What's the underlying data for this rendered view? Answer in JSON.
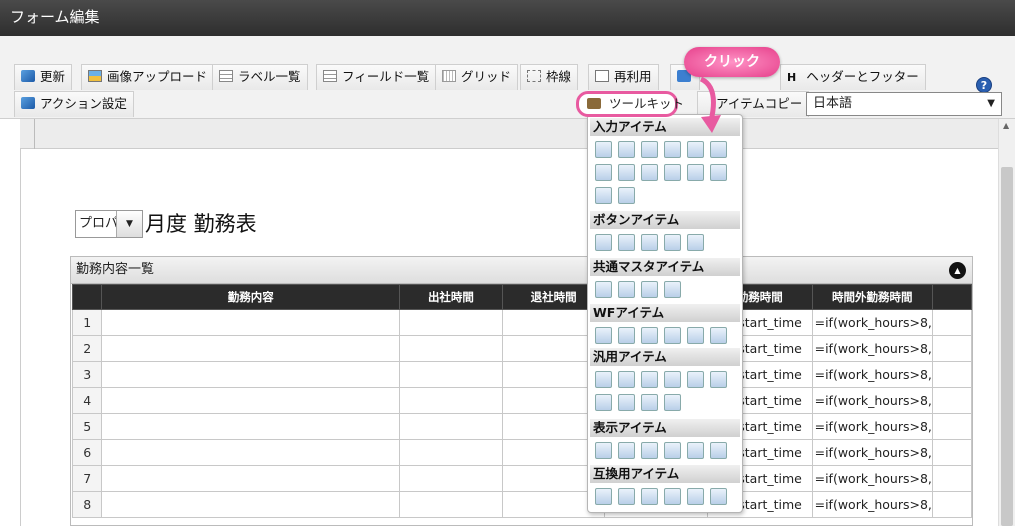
{
  "title": "フォーム編集",
  "toolbar": {
    "row1": [
      "更新",
      "画像アップロード",
      "ラベル一覧",
      "フィールド一覧",
      "グリッド",
      "枠線",
      "再利用",
      "",
      "ヘッダーとフッター"
    ],
    "header_footer_prefix": "H",
    "row2": [
      "アクション設定",
      "ツールキット",
      "アイテムコピー"
    ],
    "language": "日本語"
  },
  "callout": "クリック",
  "form": {
    "period_value": "プロパ",
    "heading": "月度 勤務表",
    "panel_title": "勤務内容一覧",
    "columns": [
      "",
      "勤務内容",
      "出社時間",
      "退社時間",
      "",
      "勤務時間",
      "時間外勤務時間"
    ],
    "rows": [
      {
        "num": "1",
        "work": "and(start_time",
        "overtime": "=if(work_hours>8,"
      },
      {
        "num": "2",
        "work": "and(start_time",
        "overtime": "=if(work_hours>8,"
      },
      {
        "num": "3",
        "work": "and(start_time",
        "overtime": "=if(work_hours>8,"
      },
      {
        "num": "4",
        "work": "and(start_time",
        "overtime": "=if(work_hours>8,"
      },
      {
        "num": "5",
        "work": "and(start_time",
        "overtime": "=if(work_hours>8,"
      },
      {
        "num": "6",
        "work": "and(start_time",
        "overtime": "=if(work_hours>8,"
      },
      {
        "num": "7",
        "work": "and(start_time",
        "overtime": "=if(work_hours>8,"
      },
      {
        "num": "8",
        "work": "and(start_time",
        "overtime": "=if(work_hours>8,"
      }
    ]
  },
  "toolkit": {
    "categories": [
      {
        "label": "入力アイテム",
        "icon_count": 14
      },
      {
        "label": "ボタンアイテム",
        "icon_count": 5
      },
      {
        "label": "共通マスタアイテム",
        "icon_count": 4
      },
      {
        "label": "WFアイテム",
        "icon_count": 6
      },
      {
        "label": "汎用アイテム",
        "icon_count": 10
      },
      {
        "label": "表示アイテム",
        "icon_count": 6
      },
      {
        "label": "互換用アイテム",
        "icon_count": 6
      }
    ]
  },
  "colors": {
    "titlebar": "#3a3a3a",
    "accent_pink": "#e85aa0",
    "table_header": "#2b2b2b"
  }
}
